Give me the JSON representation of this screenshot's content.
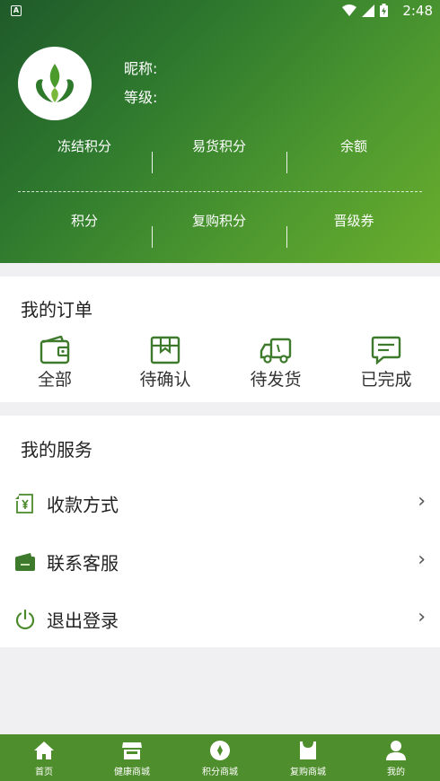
{
  "status_bar": {
    "time": "2:48"
  },
  "profile": {
    "nickname_label": "昵称:",
    "level_label": "等级:"
  },
  "stats_row1": [
    {
      "label": "冻结积分"
    },
    {
      "label": "易货积分"
    },
    {
      "label": "余额"
    }
  ],
  "stats_row2": [
    {
      "label": "积分"
    },
    {
      "label": "复购积分"
    },
    {
      "label": "晋级券"
    }
  ],
  "orders": {
    "title": "我的订单",
    "items": [
      {
        "label": "全部",
        "icon": "wallet-icon"
      },
      {
        "label": "待确认",
        "icon": "box-icon"
      },
      {
        "label": "待发货",
        "icon": "truck-icon"
      },
      {
        "label": "已完成",
        "icon": "message-icon"
      }
    ]
  },
  "services": {
    "title": "我的服务",
    "items": [
      {
        "label": "收款方式",
        "icon": "payment-icon"
      },
      {
        "label": "联系客服",
        "icon": "customer-service-icon"
      },
      {
        "label": "退出登录",
        "icon": "power-icon"
      }
    ],
    "chevron": "›"
  },
  "bottom_nav": [
    {
      "label": "首页",
      "icon": "home-icon"
    },
    {
      "label": "健康商城",
      "icon": "store-icon"
    },
    {
      "label": "积分商城",
      "icon": "points-icon"
    },
    {
      "label": "复购商城",
      "icon": "shopping-bag-icon"
    },
    {
      "label": "我的",
      "icon": "user-icon"
    }
  ],
  "colors": {
    "brand_green": "#4f8e2c",
    "header_dark": "#1f5a2a",
    "header_light": "#6aae2e"
  }
}
